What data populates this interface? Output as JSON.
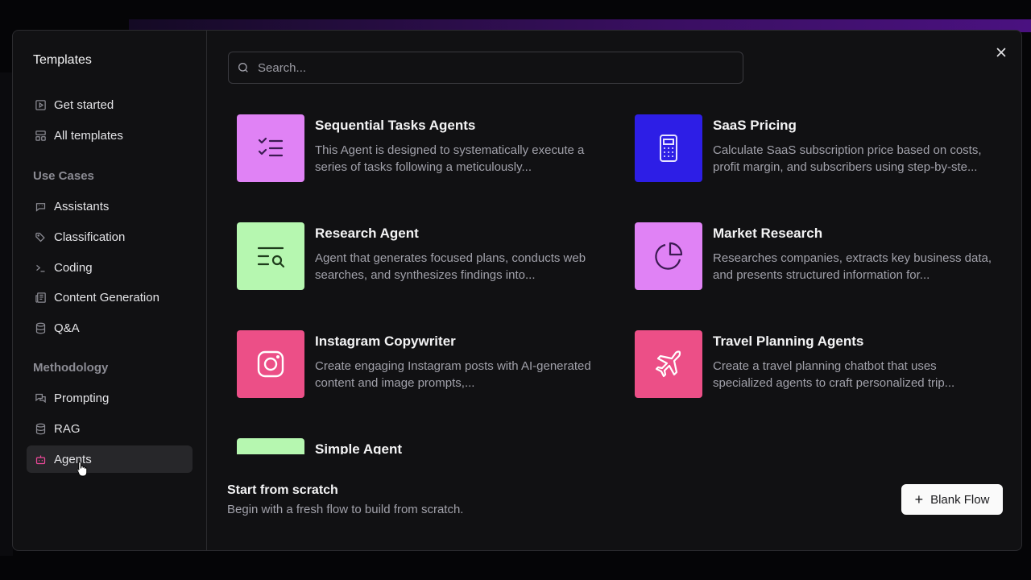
{
  "sidebar": {
    "title": "Templates",
    "top_items": [
      {
        "label": "Get started",
        "icon": "play-square-icon"
      },
      {
        "label": "All templates",
        "icon": "layout-grid-icon"
      }
    ],
    "use_cases_label": "Use Cases",
    "use_cases": [
      {
        "label": "Assistants",
        "icon": "bot-message-icon"
      },
      {
        "label": "Classification",
        "icon": "tags-icon"
      },
      {
        "label": "Coding",
        "icon": "terminal-icon"
      },
      {
        "label": "Content Generation",
        "icon": "newspaper-icon"
      },
      {
        "label": "Q&A",
        "icon": "database-icon"
      }
    ],
    "methodology_label": "Methodology",
    "methodology": [
      {
        "label": "Prompting",
        "icon": "messages-icon"
      },
      {
        "label": "RAG",
        "icon": "database-icon"
      },
      {
        "label": "Agents",
        "icon": "bot-icon",
        "active": true
      }
    ]
  },
  "search": {
    "placeholder": "Search..."
  },
  "cards": [
    {
      "title": "Sequential Tasks Agents",
      "desc": "This Agent is designed to systematically execute a series of tasks following a meticulously...",
      "icon": "list-checks-icon",
      "color": "#e082f5"
    },
    {
      "title": "SaaS Pricing",
      "desc": "Calculate SaaS subscription price based on costs, profit margin, and subscribers using step-by-ste...",
      "icon": "calculator-icon",
      "color": "#2d1ee6"
    },
    {
      "title": "Research Agent",
      "desc": "Agent that generates focused plans, conducts web searches, and synthesizes findings into...",
      "icon": "text-search-icon",
      "color": "#b6f7b0"
    },
    {
      "title": "Market Research",
      "desc": "Researches companies, extracts key business data, and presents structured information for...",
      "icon": "pie-chart-icon",
      "color": "#e082f5"
    },
    {
      "title": "Instagram Copywriter",
      "desc": "Create engaging Instagram posts with AI-generated content and image prompts,...",
      "icon": "instagram-icon",
      "color": "#ec4f87"
    },
    {
      "title": "Travel Planning Agents",
      "desc": "Create a travel planning chatbot that uses specialized agents to craft personalized trip...",
      "icon": "plane-icon",
      "color": "#ec4f87"
    },
    {
      "title": "Simple Agent",
      "desc": "",
      "icon": "bot-icon",
      "color": "#b6f7b0"
    }
  ],
  "footer": {
    "title": "Start from scratch",
    "subtitle": "Begin with a fresh flow to build from scratch.",
    "button_label": "Blank Flow"
  }
}
